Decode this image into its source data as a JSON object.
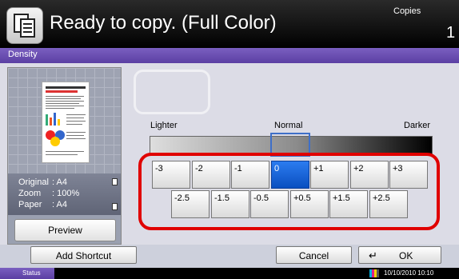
{
  "header": {
    "title": "Ready to copy. (Full Color)",
    "copies_label": "Copies",
    "copies_count": "1"
  },
  "screen_title": "Density",
  "preview": {
    "info": [
      {
        "key": "Original",
        "value": ": A4"
      },
      {
        "key": "Zoom",
        "value": ": 100%"
      },
      {
        "key": "Paper",
        "value": ": A4"
      }
    ],
    "button_label": "Preview"
  },
  "density": {
    "lighter": "Lighter",
    "normal": "Normal",
    "darker": "Darker",
    "row1": [
      "-3",
      "-2",
      "-1",
      "0",
      "+1",
      "+2",
      "+3"
    ],
    "row2": [
      "-2.5",
      "-1.5",
      "-0.5",
      "+0.5",
      "+1.5",
      "+2.5"
    ],
    "selected": "0"
  },
  "footer": {
    "add_shortcut": "Add Shortcut",
    "cancel": "Cancel",
    "ok": "OK"
  },
  "status": {
    "label": "Status",
    "datetime": "10/10/2010 10:10"
  },
  "colors": {
    "header_bg": "#000000",
    "accent_purple": "#6a4fb5",
    "selected_blue": "#1a64dd",
    "highlight_red": "#e00000"
  }
}
